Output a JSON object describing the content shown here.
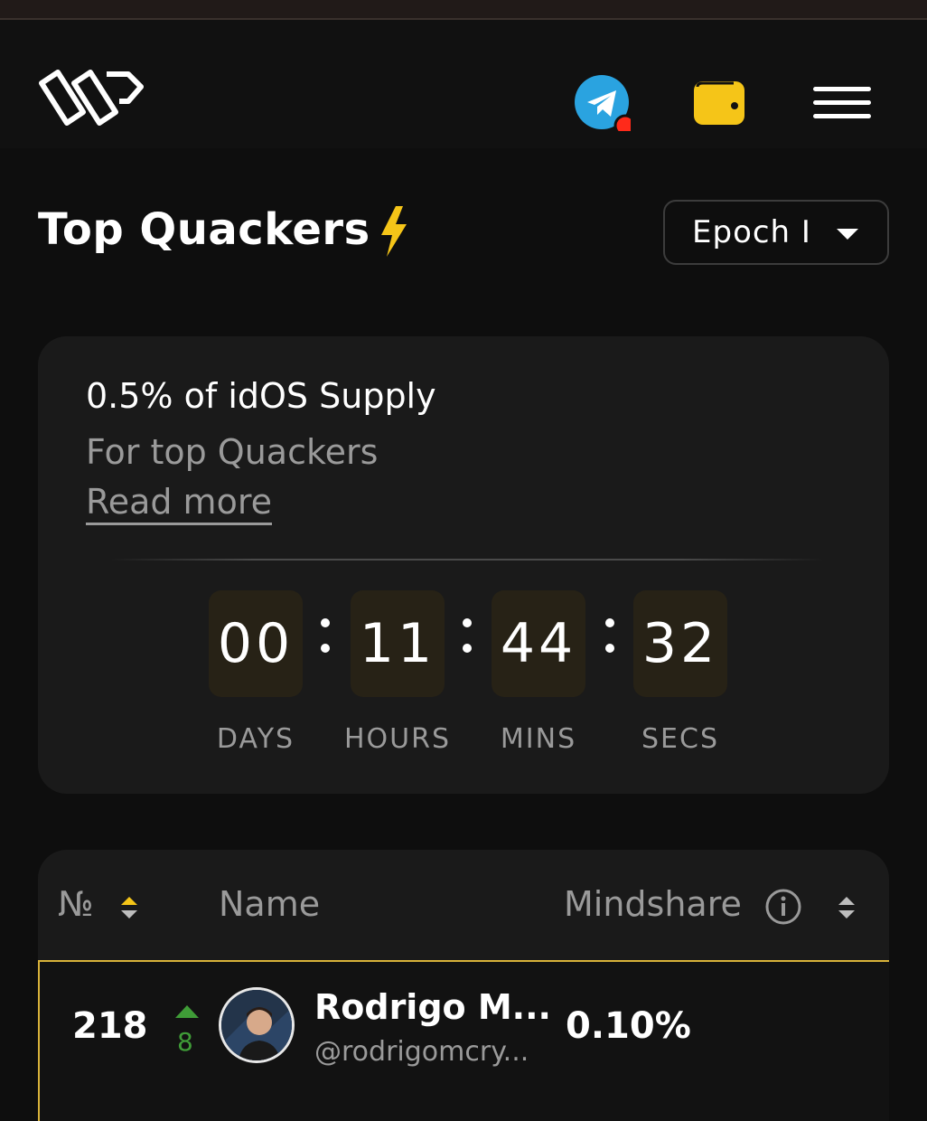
{
  "header": {
    "logo_icon": "brand-logo-icon",
    "telegram_icon": "telegram-icon",
    "notification_color": "#ff2a1a",
    "wallet_icon": "wallet-icon",
    "menu_icon": "hamburger-menu-icon"
  },
  "page": {
    "title": "Top Quackers",
    "title_icon": "lightning-bolt-icon",
    "epoch_select": {
      "selected": "Epoch I",
      "icon": "caret-down-icon"
    }
  },
  "promo": {
    "headline": "0.5% of idOS Supply",
    "subtext": "For top Quackers",
    "link": "Read more"
  },
  "countdown": {
    "days": "00",
    "hours": "11",
    "mins": "44",
    "secs": "32",
    "labels": {
      "days": "DAYS",
      "hours": "HOURS",
      "mins": "MINS",
      "secs": "SECS"
    }
  },
  "table": {
    "columns": {
      "rank": "№",
      "name": "Name",
      "mindshare": "Mindshare"
    },
    "rows": [
      {
        "rank": "218",
        "change": "8",
        "name": "Rodrigo M...",
        "handle": "@rodrigomcry...",
        "mindshare": "0.10%"
      }
    ]
  },
  "colors": {
    "accent_yellow": "#f5c518",
    "telegram_blue": "#2aa3e0",
    "up_green": "#3f9c37",
    "highlight_border": "#d8b23a"
  }
}
